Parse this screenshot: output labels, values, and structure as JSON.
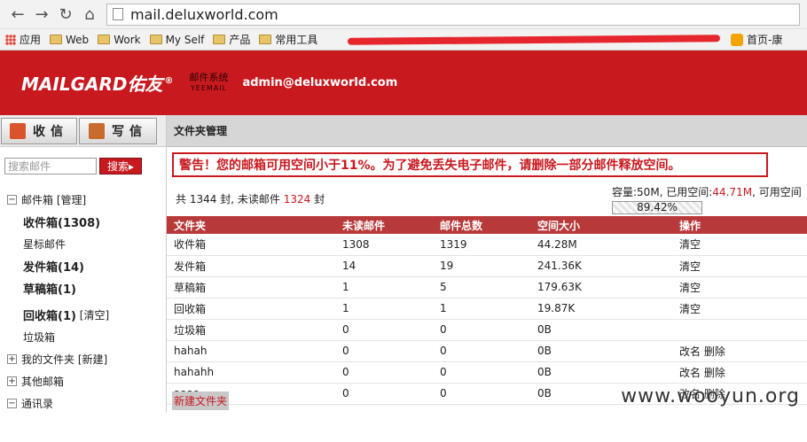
{
  "browser": {
    "url": "mail.deluxworld.com",
    "bookmarks": [
      {
        "label": "应用",
        "icon": "apps-grid-icon"
      },
      {
        "label": "Web",
        "icon": "folder-icon"
      },
      {
        "label": "Work",
        "icon": "folder-icon"
      },
      {
        "label": "My Self",
        "icon": "folder-icon"
      },
      {
        "label": "产品",
        "icon": "folder-icon"
      },
      {
        "label": "常用工具",
        "icon": "folder-icon"
      }
    ],
    "bookmark_right": {
      "label": "首页-康",
      "icon": "home-page-icon"
    }
  },
  "header": {
    "logo": "MAILGARD佑友",
    "logo_mark": "®",
    "sublogo_cn": "邮件系统",
    "sublogo_en": "YEEMAIL",
    "user_email": "admin@deluxworld.com"
  },
  "sidebar": {
    "receive_label": "收信",
    "write_label": "写信",
    "search_placeholder": "搜索邮件",
    "search_button": "搜索",
    "tree": {
      "mailbox": {
        "label": "邮件箱",
        "manage": "[管理]"
      },
      "inbox": "收件箱(1308)",
      "starred": "星标邮件",
      "sent": "发件箱(14)",
      "drafts": "草稿箱(1)",
      "trash": "回收箱(1)",
      "trash_empty": "[清空]",
      "junk": "垃圾箱",
      "my_folders": {
        "label": "我的文件夹",
        "new": "[新建]"
      },
      "other_mailbox": "其他邮箱",
      "contacts": "通讯录"
    }
  },
  "main": {
    "title": "文件夹管理",
    "warning": "警告！您的邮箱可用空间小于11%。为了避免丢失电子邮件，请删除一部分邮件释放空间。",
    "counts": {
      "prefix": "共",
      "total": "1344",
      "mid": "封, 未读邮件",
      "unread": "1324",
      "suffix": "封"
    },
    "quota": {
      "cap_label": "容量:50M, 已用空间:",
      "used": "44.71M",
      "avail_label": ", 可用空间",
      "percent": "89.42%"
    },
    "table": {
      "headers": [
        "文件夹",
        "未读邮件",
        "邮件总数",
        "空间大小",
        "操作"
      ],
      "rows": [
        {
          "name": "收件箱",
          "unread": "1308",
          "total": "1319",
          "size": "44.28M",
          "action": "清空"
        },
        {
          "name": "发件箱",
          "unread": "14",
          "total": "19",
          "size": "241.36K",
          "action": "清空"
        },
        {
          "name": "草稿箱",
          "unread": "1",
          "total": "5",
          "size": "179.63K",
          "action": "清空"
        },
        {
          "name": "回收箱",
          "unread": "1",
          "total": "1",
          "size": "19.87K",
          "action": "清空"
        },
        {
          "name": "垃圾箱",
          "unread": "0",
          "total": "0",
          "size": "0B",
          "action": ""
        },
        {
          "name": "hahah",
          "unread": "0",
          "total": "0",
          "size": "0B",
          "action": "改名 删除"
        },
        {
          "name": "hahahh",
          "unread": "0",
          "total": "0",
          "size": "0B",
          "action": "改名 删除"
        },
        {
          "name": "aaaa",
          "unread": "0",
          "total": "0",
          "size": "0B",
          "action": "改名 删除"
        }
      ]
    },
    "new_folder": "新建文件夹"
  },
  "watermark": "www.wooyun.org",
  "colors": {
    "brand_red": "#c8191f",
    "table_header": "#b8393a"
  }
}
